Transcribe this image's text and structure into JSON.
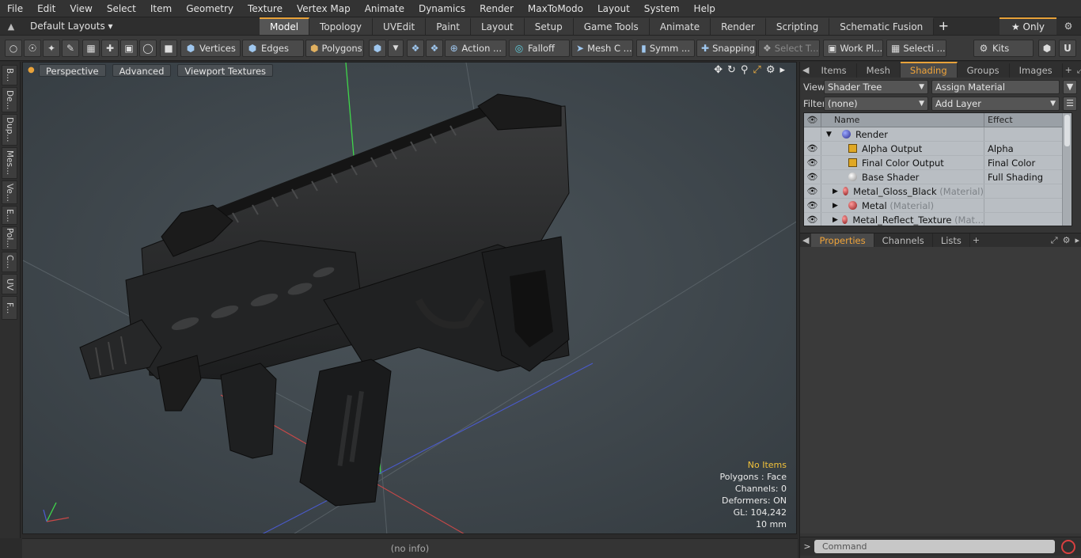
{
  "menu": [
    "File",
    "Edit",
    "View",
    "Select",
    "Item",
    "Geometry",
    "Texture",
    "Vertex Map",
    "Animate",
    "Dynamics",
    "Render",
    "MaxToModo",
    "Layout",
    "System",
    "Help"
  ],
  "layout": {
    "selector": "Default Layouts ▾",
    "tabs": [
      "Model",
      "Topology",
      "UVEdit",
      "Paint",
      "Layout",
      "Setup",
      "Game Tools",
      "Animate",
      "Render",
      "Scripting",
      "Schematic Fusion"
    ],
    "active_tab": "Model",
    "only_label": "★ Only"
  },
  "toolbar": {
    "vertices": "Vertices",
    "edges": "Edges",
    "polygons": "Polygons",
    "action": "Action ...",
    "falloff": "Falloff",
    "mesh_c": "Mesh C ...",
    "symm": "Symm ...",
    "snapping": "Snapping",
    "select_t": "Select T...",
    "work_pl": "Work Pl...",
    "selecti": "Selecti ...",
    "kits": "Kits"
  },
  "left_tabs": [
    "B...",
    "De...",
    "Dup...",
    "Mes...",
    "Ve...",
    "E...",
    "Pol...",
    "C...",
    "UV",
    "F..."
  ],
  "viewport": {
    "buttons": [
      "Perspective",
      "Advanced",
      "Viewport Textures"
    ],
    "info": {
      "items": "No Items",
      "polygons": "Polygons : Face",
      "channels": "Channels: 0",
      "deformers": "Deformers: ON",
      "gl": "GL: 104,242",
      "unit": "10 mm"
    }
  },
  "status": "(no info)",
  "right": {
    "tabs": [
      "Items",
      "Mesh ...",
      "Shading",
      "Groups",
      "Images"
    ],
    "active_tab": "Shading",
    "view_label": "View",
    "view_value": "Shader Tree",
    "assign_material": "Assign Material",
    "filter_label": "Filter",
    "filter_value": "(none)",
    "add_layer": "Add Layer",
    "tree_header": {
      "name": "Name",
      "effect": "Effect"
    },
    "tree_rows": [
      {
        "name": "Render",
        "suffix": "",
        "effect": "",
        "icon": "render"
      },
      {
        "name": "Alpha Output",
        "suffix": "",
        "effect": "Alpha",
        "icon": "output"
      },
      {
        "name": "Final Color Output",
        "suffix": "",
        "effect": "Final Color",
        "icon": "output"
      },
      {
        "name": "Base Shader",
        "suffix": "",
        "effect": "Full Shading",
        "icon": "shader"
      },
      {
        "name": "Metal_Gloss_Black",
        "suffix": "(Material)",
        "effect": "",
        "icon": "material"
      },
      {
        "name": "Metal",
        "suffix": "(Material)",
        "effect": "",
        "icon": "material"
      },
      {
        "name": "Metal_Reflect_Texture",
        "suffix": "(Mat...",
        "effect": "",
        "icon": "material"
      }
    ],
    "bottom_tabs": [
      "Properties",
      "Channels",
      "Lists"
    ],
    "bottom_active": "Properties",
    "command_placeholder": "Command"
  }
}
